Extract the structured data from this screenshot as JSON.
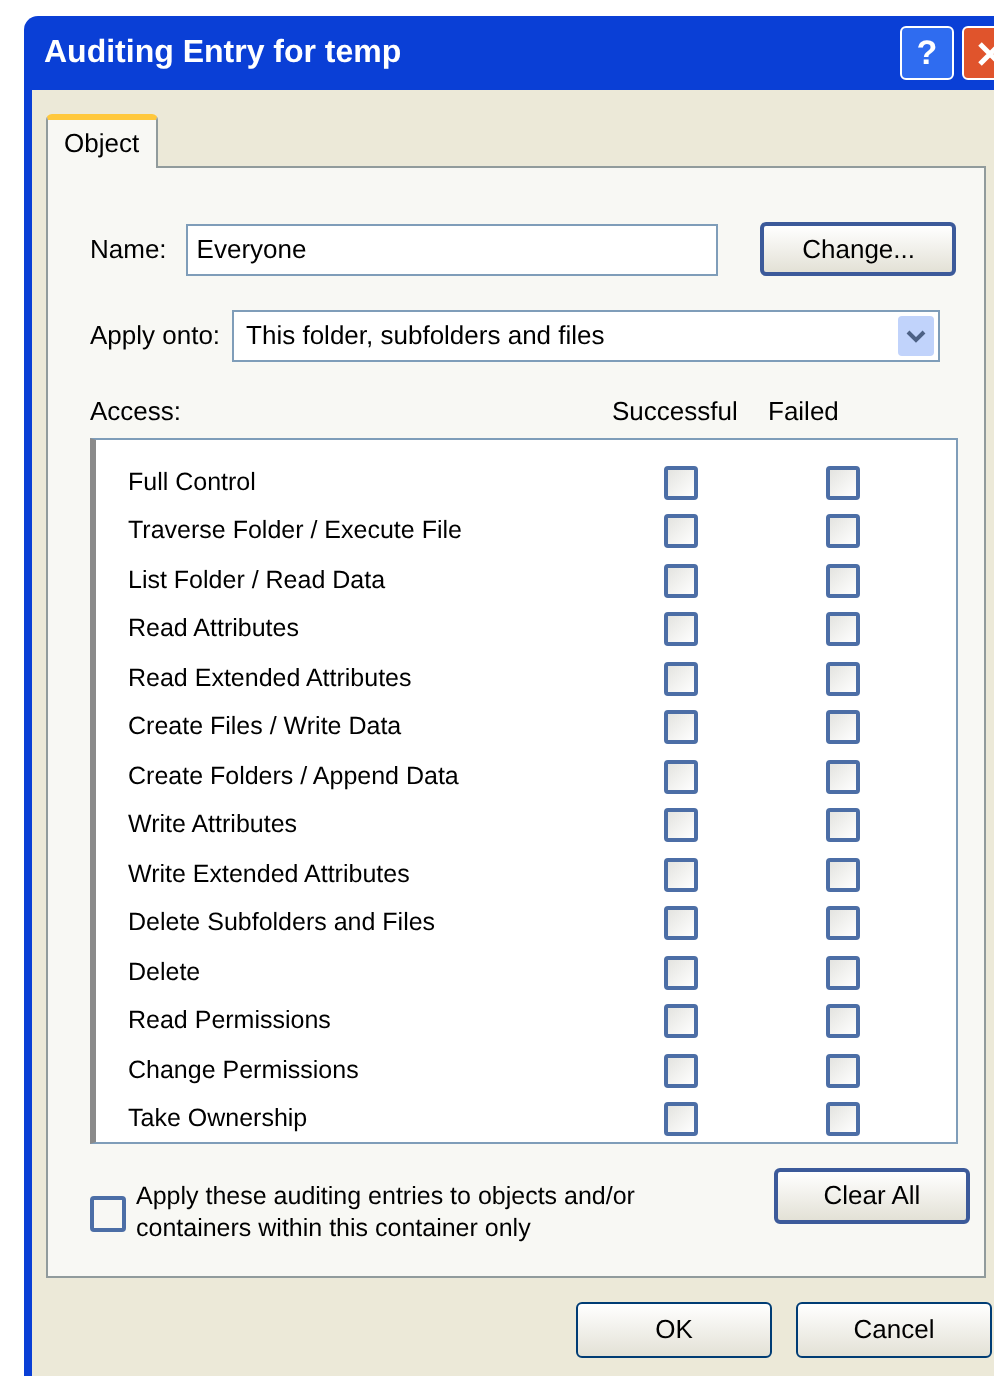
{
  "window": {
    "title": "Auditing Entry for temp",
    "title_buttons": [
      {
        "kind": "help",
        "label": "?"
      },
      {
        "kind": "close"
      }
    ]
  },
  "tabs": [
    {
      "label": "Object",
      "selected": true
    }
  ],
  "name_field": {
    "label": "Name:",
    "value": "Everyone",
    "button": "Change..."
  },
  "apply_onto": {
    "label": "Apply onto:",
    "value": "This folder, subfolders and files"
  },
  "access": {
    "label": "Access:",
    "columns": [
      "Successful",
      "Failed"
    ],
    "rows": [
      {
        "name": "Full Control",
        "successful": false,
        "failed": false
      },
      {
        "name": "Traverse Folder / Execute File",
        "successful": false,
        "failed": false
      },
      {
        "name": "List Folder / Read Data",
        "successful": false,
        "failed": false
      },
      {
        "name": "Read Attributes",
        "successful": false,
        "failed": false
      },
      {
        "name": "Read Extended Attributes",
        "successful": false,
        "failed": false
      },
      {
        "name": "Create Files / Write Data",
        "successful": false,
        "failed": false
      },
      {
        "name": "Create Folders / Append Data",
        "successful": false,
        "failed": false
      },
      {
        "name": "Write Attributes",
        "successful": false,
        "failed": false
      },
      {
        "name": "Write Extended Attributes",
        "successful": false,
        "failed": false
      },
      {
        "name": "Delete Subfolders and Files",
        "successful": false,
        "failed": false
      },
      {
        "name": "Delete",
        "successful": false,
        "failed": false
      },
      {
        "name": "Read Permissions",
        "successful": false,
        "failed": false
      },
      {
        "name": "Change Permissions",
        "successful": false,
        "failed": false
      },
      {
        "name": "Take Ownership",
        "successful": false,
        "failed": false
      }
    ]
  },
  "apply_only": {
    "label": "Apply these auditing entries to objects and/or containers within this container only",
    "checked": false
  },
  "clear_button": "Clear All",
  "buttons": [
    "OK",
    "Cancel"
  ]
}
